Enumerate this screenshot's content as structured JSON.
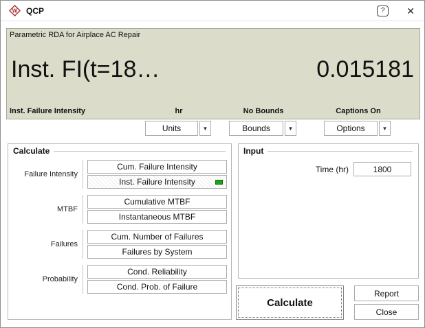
{
  "window": {
    "title": "QCP"
  },
  "icons": {
    "logo_letter": "W",
    "help_glyph": "?",
    "close_glyph": "✕",
    "dropdown_arrow": "▼"
  },
  "colors": {
    "panel_bg": "#dbdcca",
    "indicator_green": "#1ea21e",
    "logo_red": "#a92c2c"
  },
  "results_panel": {
    "header": "Parametric RDA for Airplace AC Repair",
    "result_label": "Inst. FI(t=18…",
    "result_value": "0.015181",
    "status": {
      "metric": "Inst. Failure Intensity",
      "units": "hr",
      "bounds": "No Bounds",
      "captions": "Captions On"
    }
  },
  "dropdowns": [
    {
      "label": "Units"
    },
    {
      "label": "Bounds"
    },
    {
      "label": "Options"
    }
  ],
  "calculate_group": {
    "title": "Calculate",
    "sections": [
      {
        "label": "Failure Intensity",
        "buttons": [
          {
            "label": "Cum. Failure Intensity",
            "selected": false
          },
          {
            "label": "Inst. Failure Intensity",
            "selected": true
          }
        ]
      },
      {
        "label": "MTBF",
        "buttons": [
          {
            "label": "Cumulative MTBF",
            "selected": false
          },
          {
            "label": "Instantaneous MTBF",
            "selected": false
          }
        ]
      },
      {
        "label": "Failures",
        "buttons": [
          {
            "label": "Cum. Number of Failures",
            "selected": false
          },
          {
            "label": "Failures by System",
            "selected": false
          }
        ]
      },
      {
        "label": "Probability",
        "buttons": [
          {
            "label": "Cond. Reliability",
            "selected": false
          },
          {
            "label": "Cond. Prob. of Failure",
            "selected": false
          }
        ]
      }
    ]
  },
  "input_group": {
    "title": "Input",
    "field_label": "Time (hr)",
    "field_value": "1800"
  },
  "actions": {
    "calculate": "Calculate",
    "report": "Report",
    "close": "Close"
  }
}
